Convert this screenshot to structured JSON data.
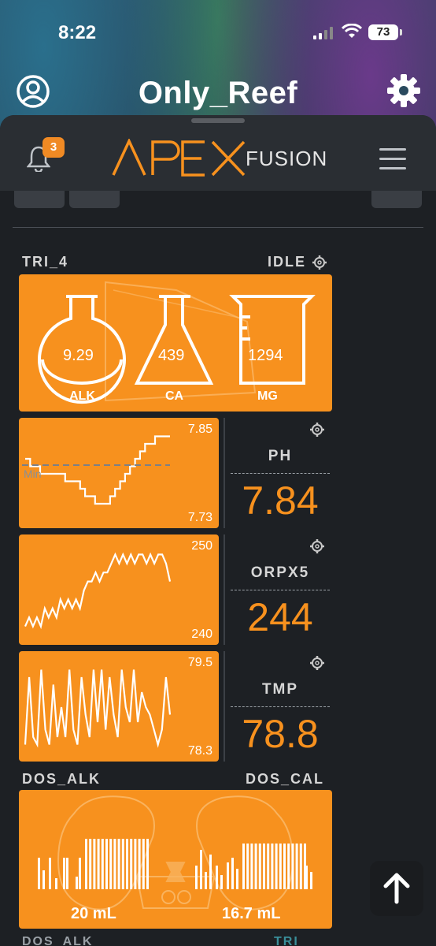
{
  "status": {
    "time": "8:22",
    "battery": "73"
  },
  "header": {
    "title": "Only_Reef"
  },
  "nav": {
    "notification_count": "3",
    "logo_main": "APEX",
    "logo_sub": "FUSION"
  },
  "tri": {
    "name": "TRI_4",
    "state": "IDLE",
    "alk_value": "9.29",
    "alk_label": "ALK",
    "ca_value": "439",
    "ca_label": "CA",
    "mg_value": "1294",
    "mg_label": "MG"
  },
  "probes": [
    {
      "label": "PH",
      "value": "7.84",
      "axis_max": "7.85",
      "axis_min": "7.73",
      "marker": "Min",
      "chart_data": {
        "type": "line",
        "ylim": [
          7.73,
          7.85
        ],
        "values": [
          7.81,
          7.8,
          7.8,
          7.79,
          7.79,
          7.79,
          7.79,
          7.79,
          7.78,
          7.78,
          7.78,
          7.77,
          7.76,
          7.76,
          7.75,
          7.75,
          7.75,
          7.76,
          7.77,
          7.78,
          7.79,
          7.8,
          7.81,
          7.82,
          7.83,
          7.83,
          7.84,
          7.84,
          7.84,
          7.84
        ]
      }
    },
    {
      "label": "ORPX5",
      "value": "244",
      "axis_max": "250",
      "axis_min": "240",
      "chart_data": {
        "type": "line",
        "ylim": [
          240,
          250
        ],
        "values": [
          241,
          242,
          241,
          242,
          241,
          243,
          242,
          243,
          242,
          244,
          243,
          244,
          243,
          244,
          243,
          245,
          246,
          246,
          247,
          246,
          247,
          247,
          248,
          249,
          248,
          249,
          248,
          249,
          248,
          249,
          249,
          248,
          249,
          248,
          249,
          249,
          248,
          246
        ]
      }
    },
    {
      "label": "TMP",
      "value": "78.8",
      "axis_max": "79.5",
      "axis_min": "78.3",
      "chart_data": {
        "type": "line",
        "ylim": [
          78.3,
          79.5
        ],
        "values": [
          78.4,
          79.3,
          78.5,
          78.4,
          79.4,
          78.6,
          78.4,
          79.2,
          78.5,
          78.9,
          78.5,
          79.4,
          78.6,
          78.4,
          79.3,
          78.8,
          78.5,
          79.4,
          78.7,
          79.4,
          78.6,
          79.3,
          78.8,
          78.5,
          79.4,
          78.9,
          78.7,
          79.4,
          78.7,
          79.1,
          78.9,
          78.8,
          78.6,
          78.4,
          78.6,
          79.3,
          78.8
        ]
      }
    }
  ],
  "dosing": {
    "left_label": "DOS_ALK",
    "right_label": "DOS_CAL",
    "left_amount": "20 mL",
    "right_amount": "16.7 mL",
    "next_left": "DOS_ALK",
    "next_right": "TRI"
  },
  "colors": {
    "accent": "#f7911e",
    "panel": "#1d2024",
    "navbar": "#2a2e33"
  },
  "icons": [
    "user-icon",
    "gear-icon",
    "bell-icon",
    "menu-icon",
    "arrow-up-icon"
  ]
}
